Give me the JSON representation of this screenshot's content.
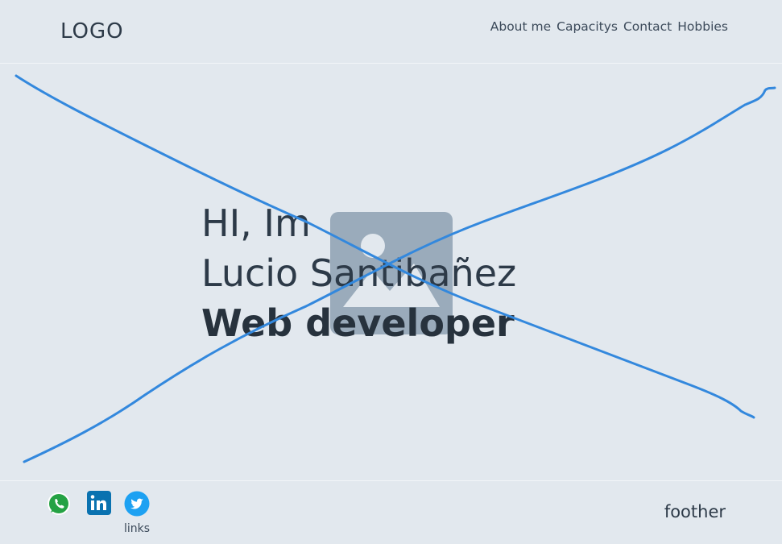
{
  "header": {
    "logo": "LOGO",
    "nav": [
      "About me",
      "Capacitys",
      "Contact",
      "Hobbies"
    ]
  },
  "hero": {
    "greeting": "HI, Im",
    "name": "Lucio Santibañez",
    "role": "Web developer",
    "image_icon": "image-placeholder-icon"
  },
  "footer": {
    "social_icons": [
      "whatsapp-icon",
      "linkedin-icon",
      "twitter-icon"
    ],
    "links_label": "links",
    "foother": "foother"
  },
  "colors": {
    "background": "#e2e8ee",
    "text": "#2d3a48",
    "placeholder": "#9aabbb",
    "cross_line": "#3388dd",
    "whatsapp": "#25a244",
    "linkedin": "#0a72b0",
    "twitter": "#1da1f2"
  }
}
